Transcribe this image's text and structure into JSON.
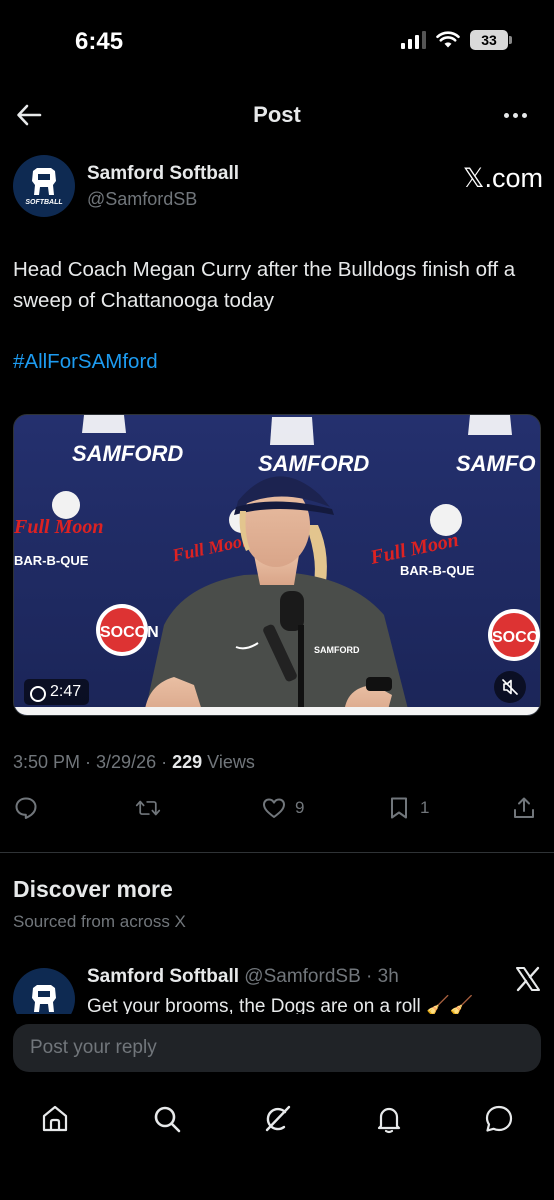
{
  "status_bar": {
    "time": "6:45",
    "battery": "33"
  },
  "header": {
    "title": "Post"
  },
  "author": {
    "name": "Samford Softball",
    "handle": "@SamfordSB",
    "avatar_text": "SOFTBALL",
    "badge": "𝕏.com"
  },
  "tweet": {
    "text": "Head Coach Megan Curry after the Bulldogs finish off a sweep of Chattanooga today",
    "hashtag": "#AllForSAMford",
    "video_duration": "2:47",
    "backdrop": {
      "brand_left": "SAMFORD",
      "brand_center": "SAMFORD",
      "brand_right": "SAMFO",
      "sponsor": "Full Moon",
      "sponsor_sub": "BAR-B-QUE",
      "conference": "SOCON",
      "shirt_text": "SAMFORD"
    },
    "timestamp": "3:50 PM · 3/29/26 · ",
    "views_count": "229",
    "views_label": " Views",
    "likes": "9",
    "bookmarks": "1"
  },
  "discover": {
    "title": "Discover more",
    "subtitle": "Sourced from across X",
    "item": {
      "name": "Samford Softball",
      "handle": "@SamfordSB · 3h",
      "text": "Get your brooms, the Dogs are on a roll 🧹🧹"
    }
  },
  "reply": {
    "placeholder": "Post your reply"
  },
  "icons": {
    "back": "arrow-left-icon",
    "more": "more-icon",
    "reply": "reply-icon",
    "repost": "repost-icon",
    "like": "heart-icon",
    "bookmark": "bookmark-icon",
    "share": "share-icon",
    "home": "home-icon",
    "search": "search-icon",
    "grok": "grok-icon",
    "notifications": "bell-icon",
    "messages": "messages-icon"
  },
  "colors": {
    "accent": "#1d9bf0",
    "muted": "#71767b",
    "text": "#e7e9ea",
    "background": "#000000"
  }
}
